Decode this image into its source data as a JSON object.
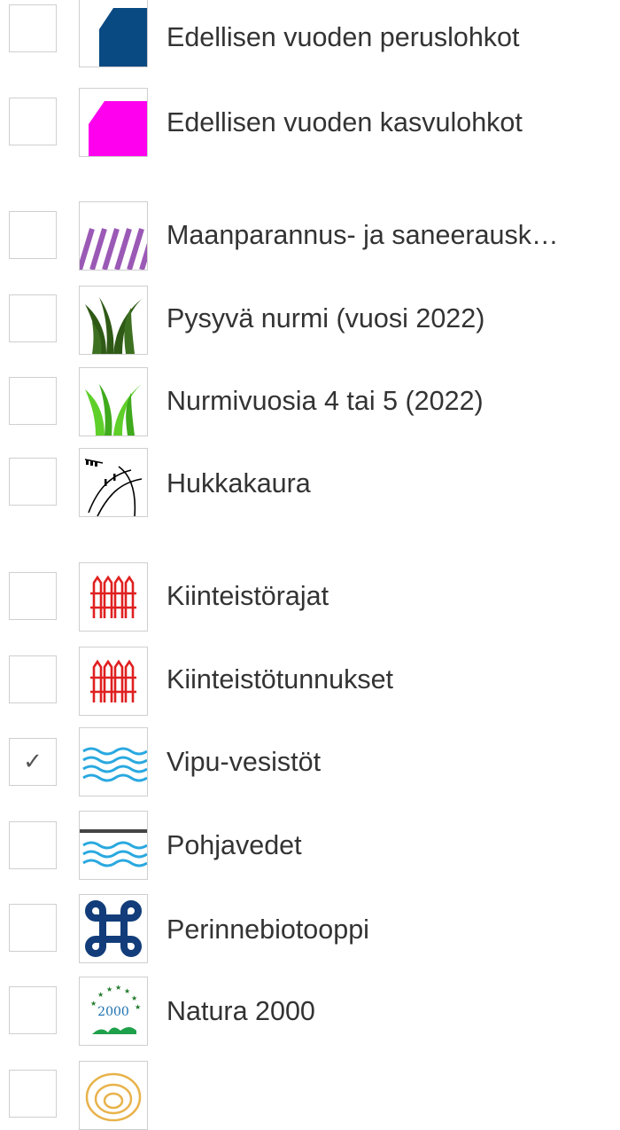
{
  "layers": [
    {
      "label": "Edellisen vuoden peruslohkot",
      "checked": false,
      "icon": "block-dark-blue-icon",
      "color": "#0a4a82"
    },
    {
      "label": "Edellisen vuoden kasvulohkot",
      "checked": false,
      "icon": "block-magenta-icon",
      "color": "#ff00ee"
    },
    {
      "label": "Maanparannus- ja saneerausk…",
      "checked": false,
      "icon": "purple-hatch-icon",
      "color": "#9b59b6"
    },
    {
      "label": "Pysyvä nurmi (vuosi 2022)",
      "checked": false,
      "icon": "dark-grass-icon",
      "color": "#2f5a16"
    },
    {
      "label": "Nurmivuosia 4 tai 5 (2022)",
      "checked": false,
      "icon": "light-grass-icon",
      "color": "#5fcf2a"
    },
    {
      "label": "Hukkakaura",
      "checked": false,
      "icon": "wild-oat-icon",
      "color": "#000000"
    },
    {
      "label": "Kiinteistörajat",
      "checked": false,
      "icon": "red-fence-icon",
      "color": "#e02020"
    },
    {
      "label": "Kiinteistötunnukset",
      "checked": false,
      "icon": "red-fence-icon",
      "color": "#e02020"
    },
    {
      "label": "Vipu-vesistöt",
      "checked": true,
      "icon": "water-waves-icon",
      "color": "#29a8e0"
    },
    {
      "label": "Pohjavedet",
      "checked": false,
      "icon": "groundwater-icon",
      "color": "#29a8e0"
    },
    {
      "label": "Perinnebiotooppi",
      "checked": false,
      "icon": "command-symbol-icon",
      "color": "#123d7a"
    },
    {
      "label": "Natura 2000",
      "checked": false,
      "icon": "natura-2000-icon",
      "color": "#0f8a4a",
      "logo_text": "2000"
    },
    {
      "label": "",
      "checked": false,
      "icon": "contour-lines-icon",
      "color": "#e8b24a"
    }
  ],
  "check_glyph": "✓"
}
